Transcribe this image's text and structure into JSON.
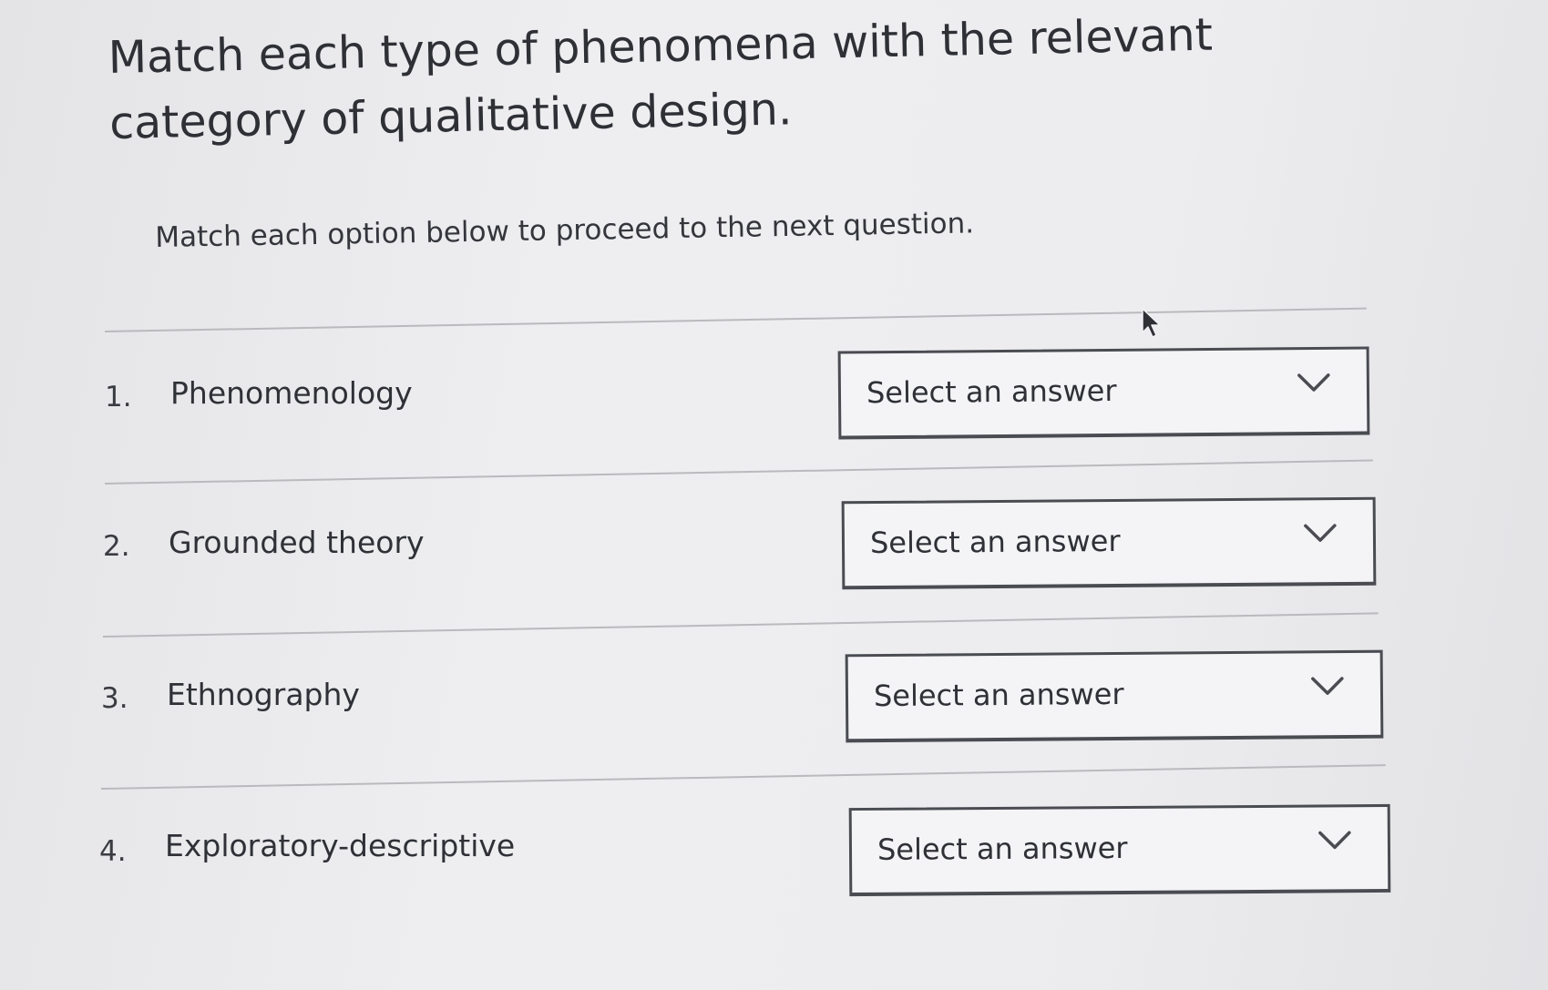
{
  "question": {
    "title": "Match each type of phenomena with the relevant category of qualitative design.",
    "instruction": "Match each option below to proceed to the next question."
  },
  "items": [
    {
      "number": "1.",
      "label": "Phenomenology",
      "selected": "Select an answer",
      "icon": "chevron-down-icon"
    },
    {
      "number": "2.",
      "label": "Grounded theory",
      "selected": "Select an answer",
      "icon": "chevron-down-icon"
    },
    {
      "number": "3.",
      "label": "Ethnography",
      "selected": "Select an answer",
      "icon": "chevron-down-icon"
    },
    {
      "number": "4.",
      "label": "Exploratory-descriptive",
      "selected": "Select an answer",
      "icon": "chevron-down-icon"
    }
  ],
  "colors": {
    "text": "#2f3137",
    "border": "#4a4c52",
    "rule": "#b9babd",
    "background": "#ececee"
  }
}
